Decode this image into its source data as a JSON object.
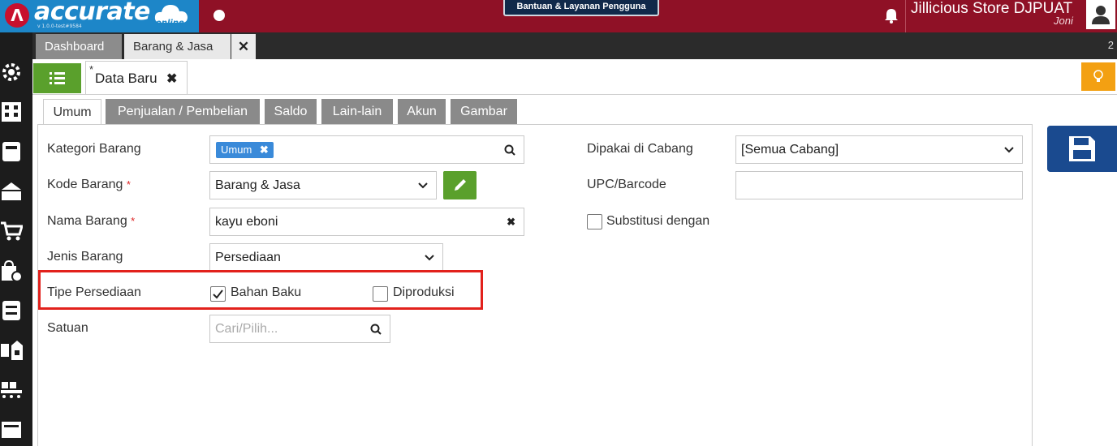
{
  "brand": {
    "logo_text": "accurate",
    "logo_sub": "online",
    "version": "v 1.0.0-test#9584"
  },
  "header": {
    "help_button": "Bantuan & Layanan Pengguna",
    "store_name": "Jillicious Store DJPUAT",
    "user_name": "Joni"
  },
  "tabs": {
    "dashboard": "Dashboard",
    "barang_jasa": "Barang & Jasa",
    "close": "✕",
    "count": "2"
  },
  "document": {
    "marker": "*",
    "title": "Data Baru",
    "close": "✖"
  },
  "subtabs": [
    "Umum",
    "Penjualan / Pembelian",
    "Saldo",
    "Lain-lain",
    "Akun",
    "Gambar"
  ],
  "form": {
    "kategori_label": "Kategori Barang",
    "kategori_chip": "Umum",
    "kode_label": "Kode Barang",
    "kode_value": "Barang & Jasa",
    "nama_label": "Nama Barang",
    "nama_value": "kayu eboni",
    "jenis_label": "Jenis Barang",
    "jenis_value": "Persediaan",
    "tipe_label": "Tipe Persediaan",
    "bahan_baku": "Bahan Baku",
    "bahan_baku_checked": true,
    "diproduksi": "Diproduksi",
    "diproduksi_checked": false,
    "satuan_label": "Satuan",
    "satuan_placeholder": "Cari/Pilih...",
    "required_mark": "*",
    "cabang_label": "Dipakai di Cabang",
    "cabang_value": "[Semua Cabang]",
    "upc_label": "UPC/Barcode",
    "upc_value": "",
    "substitusi_label": "Substitusi dengan",
    "substitusi_checked": false
  },
  "colors": {
    "topbar": "#8f1126",
    "logo_bg": "#1d86c8",
    "green": "#5aa02c",
    "save_blue": "#1a4a8f",
    "highlight": "#e2211c",
    "amber": "#f3a012"
  }
}
